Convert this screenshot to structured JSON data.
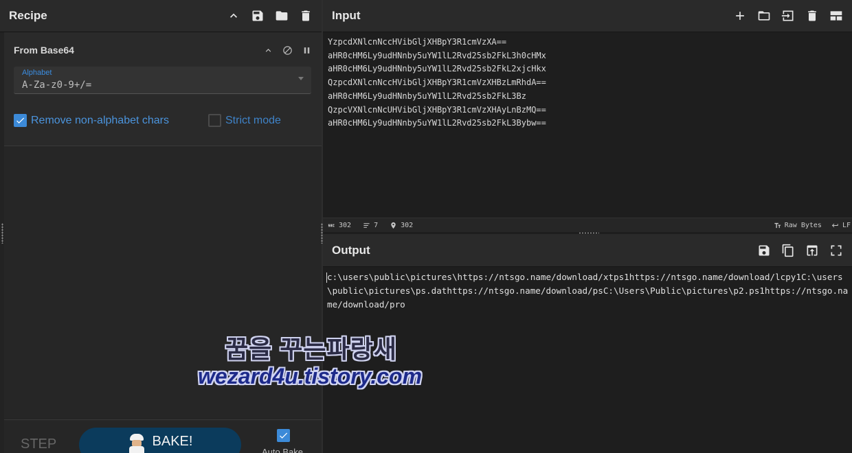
{
  "recipe": {
    "title": "Recipe",
    "operation": {
      "name": "From Base64",
      "alphabet_label": "Alphabet",
      "alphabet_value": "A-Za-z0-9+/=",
      "remove_nonalpha_label": "Remove non-alphabet chars",
      "remove_nonalpha_checked": true,
      "strict_mode_label": "Strict mode",
      "strict_mode_checked": false
    },
    "bottom": {
      "step_label": "STEP",
      "bake_label": "BAKE!",
      "auto_bake_label": "Auto Bake",
      "auto_bake_checked": true
    }
  },
  "input": {
    "title": "Input",
    "lines": [
      "YzpcdXNlcnNccHVibGljXHBpY3R1cmVzXA==",
      "aHR0cHM6Ly9udHNnby5uYW1lL2Rvd25sb2FkL3h0cHMx",
      "aHR0cHM6Ly9udHNnby5uYW1lL2Rvd25sb2FkL2xjcHkx",
      "QzpcdXNlcnNccHVibGljXHBpY3R1cmVzXHBzLmRhdA==",
      "aHR0cHM6Ly9udHNnby5uYW1lL2Rvd25sb2FkL3Bz",
      "QzpcVXNlcnNcUHVibGljXHBpY3R1cmVzXHAyLnBzMQ==",
      "aHR0cHM6Ly9udHNnby5uYW1lL2Rvd25sb2FkL3Bybw=="
    ],
    "status": {
      "length": "302",
      "lines": "7",
      "position": "302",
      "encoding": "Raw Bytes",
      "eol": "LF"
    }
  },
  "output": {
    "title": "Output",
    "text": "c:\\users\\public\\pictures\\https://ntsgo.name/download/xtps1https://ntsgo.name/download/lcpy1C:\\users\\public\\pictures\\ps.dathttps://ntsgo.name/download/psC:\\Users\\Public\\pictures\\p2.ps1https://ntsgo.name/download/pro"
  },
  "watermark": {
    "line1": "꿈을 꾸는파랑새",
    "line2": "wezard4u.tistory.com"
  },
  "icons": {
    "recipe_header": [
      "chevron-up-icon",
      "save-icon",
      "folder-icon",
      "trash-icon"
    ],
    "operation": [
      "chevron-up-icon",
      "disable-icon",
      "pause-icon"
    ],
    "input_header": [
      "plus-icon",
      "folder-icon",
      "input-tab-icon",
      "trash-icon",
      "layout-icon"
    ],
    "output_header": [
      "save-icon",
      "copy-icon",
      "replace-input-icon",
      "maximize-icon"
    ]
  },
  "colors": {
    "accent_blue": "#3c8ad8",
    "bake_button": "#0b3b5c",
    "panel_bg": "#2a2a2a",
    "editor_bg": "#1e1e1e"
  }
}
